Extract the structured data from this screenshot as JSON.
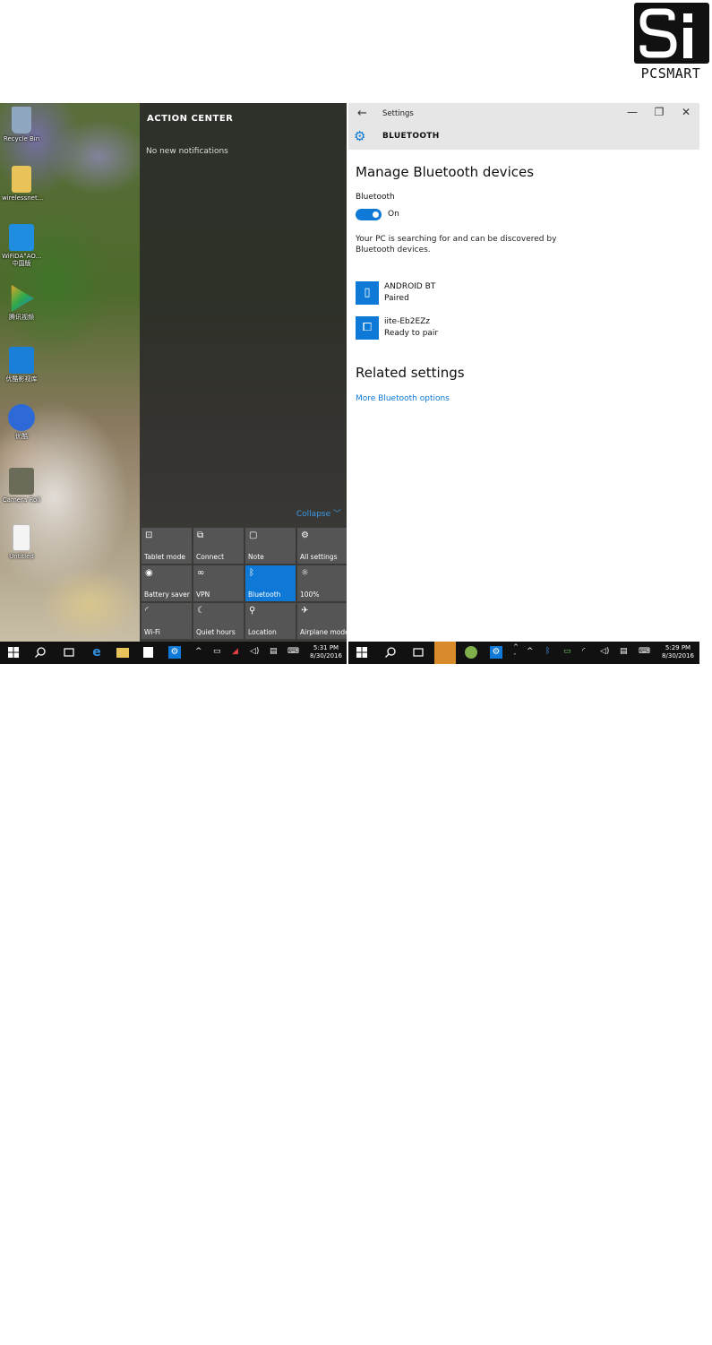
{
  "logo": {
    "wordmark": "PCSMART"
  },
  "left": {
    "desktop_icons": [
      {
        "label": "Recycle Bin",
        "icon": "recycle-bin-icon",
        "color": "#8fa7c0"
      },
      {
        "label": "wirelessnet...",
        "icon": "folder-icon",
        "color": "#e7c35a"
      },
      {
        "label": "WiFiDA°AO...\n中国版",
        "icon": "wifi-app-icon",
        "color": "#1f8ee0"
      },
      {
        "label": "腾讯视频",
        "icon": "video-play-icon",
        "color": "#2ea84a"
      },
      {
        "label": "优酷影视库",
        "icon": "youku-icon",
        "color": "#1a7fd8"
      },
      {
        "label": "优酷",
        "icon": "play-circle-icon",
        "color": "#2d6ad8"
      },
      {
        "label": "Camera Roll",
        "icon": "image-icon",
        "color": "#6b6b5a"
      },
      {
        "label": "Untitled",
        "icon": "document-icon",
        "color": "#f4f4f4"
      }
    ],
    "action_center": {
      "title": "ACTION CENTER",
      "empty_text": "No new notifications",
      "collapse_label": "Collapse ﹀",
      "tiles": [
        {
          "label": "Tablet mode",
          "icon": "tablet-mode-icon",
          "glyph": "⊡",
          "active": false
        },
        {
          "label": "Connect",
          "icon": "connect-icon",
          "glyph": "⧉",
          "active": false
        },
        {
          "label": "Note",
          "icon": "note-icon",
          "glyph": "▢",
          "active": false
        },
        {
          "label": "All settings",
          "icon": "gear-icon",
          "glyph": "⚙",
          "active": false
        },
        {
          "label": "Battery saver",
          "icon": "battery-saver-icon",
          "glyph": "◉",
          "active": false
        },
        {
          "label": "VPN",
          "icon": "vpn-icon",
          "glyph": "∞",
          "active": false
        },
        {
          "label": "Bluetooth",
          "icon": "bluetooth-icon",
          "glyph": "ᛒ",
          "active": true
        },
        {
          "label": "100%",
          "icon": "brightness-icon",
          "glyph": "☼",
          "active": false
        },
        {
          "label": "Wi-Fi",
          "icon": "wifi-icon",
          "glyph": "◜",
          "active": false
        },
        {
          "label": "Quiet hours",
          "icon": "moon-icon",
          "glyph": "☾",
          "active": false
        },
        {
          "label": "Location",
          "icon": "location-icon",
          "glyph": "⚲",
          "active": false
        },
        {
          "label": "Airplane mode",
          "icon": "airplane-icon",
          "glyph": "✈",
          "active": false
        }
      ]
    },
    "taskbar": {
      "time": "5:31 PM",
      "date": "8/30/2016"
    }
  },
  "right": {
    "title_bar": {
      "back_glyph": "←",
      "app_title": "Settings",
      "minimize_glyph": "—",
      "restore_glyph": "❐",
      "close_glyph": "✕",
      "section_title": "BLUETOOTH"
    },
    "heading": "Manage Bluetooth devices",
    "toggle_label": "Bluetooth",
    "toggle_state": "On",
    "toggle_on": true,
    "description": "Your PC is searching for and can be discovered by Bluetooth devices.",
    "devices": [
      {
        "name": "ANDROID BT",
        "status": "Paired",
        "icon": "phone-icon",
        "glyph": "▯"
      },
      {
        "name": "iite-Eb2EZz",
        "status": "Ready to pair",
        "icon": "computer-phone-icon",
        "glyph": "⧠"
      }
    ],
    "related_heading": "Related settings",
    "related_link": "More Bluetooth options",
    "taskbar": {
      "time": "5:29 PM",
      "date": "8/30/2016"
    }
  },
  "colors": {
    "accent": "#0e79d6",
    "action_center_bg": "#282828",
    "taskbar_bg": "#111111",
    "title_bar_bg": "#e6e6e6"
  }
}
